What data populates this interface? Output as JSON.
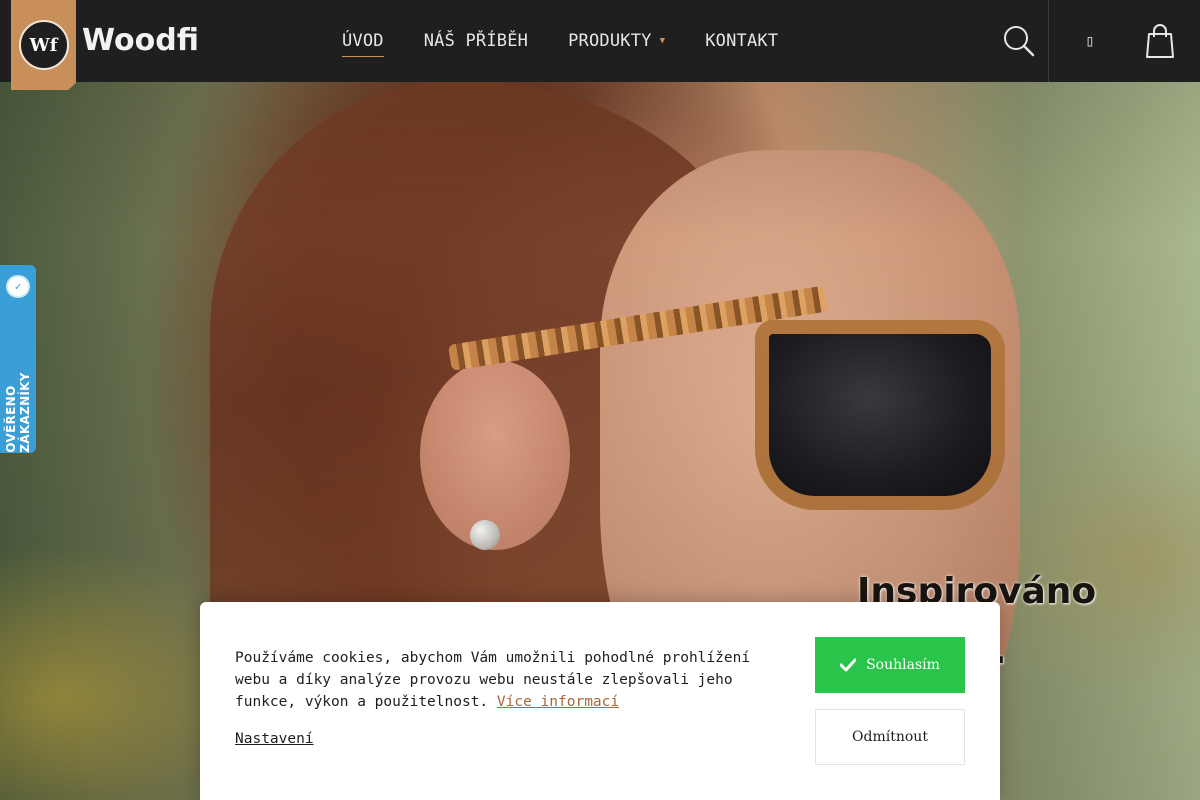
{
  "brand": {
    "logo_mark": "Wf",
    "name": "Woodfi"
  },
  "nav": {
    "items": [
      {
        "label": "ÚVOD"
      },
      {
        "label": "NÁŠ PŘÍBĚH"
      },
      {
        "label": "PRODUKTY"
      },
      {
        "label": "KONTAKT"
      }
    ]
  },
  "header_icons": {
    "search": "search-icon",
    "user": "user-icon",
    "cart": "cart-icon"
  },
  "verified_badge": {
    "label": "OVĚŘENO ZÁKAZNÍKY"
  },
  "hero": {
    "headline_line1": "Inspirováno",
    "headline_line2": "d."
  },
  "cookie_bar": {
    "text": "Používáme cookies, abychom Vám umožnili pohodlné prohlížení webu a díky analýze provozu webu neustále zlepšovali jeho funkce, výkon a použitelnost.",
    "more_link": "Více informací",
    "settings_link": "Nastavení",
    "accept_label": "Souhlasím",
    "decline_label": "Odmítnout"
  },
  "colors": {
    "header_bg": "#1f1f1f",
    "accent_wood": "#c98f5b",
    "accept_green": "#2ac44a",
    "badge_blue": "#3a9fd6"
  }
}
